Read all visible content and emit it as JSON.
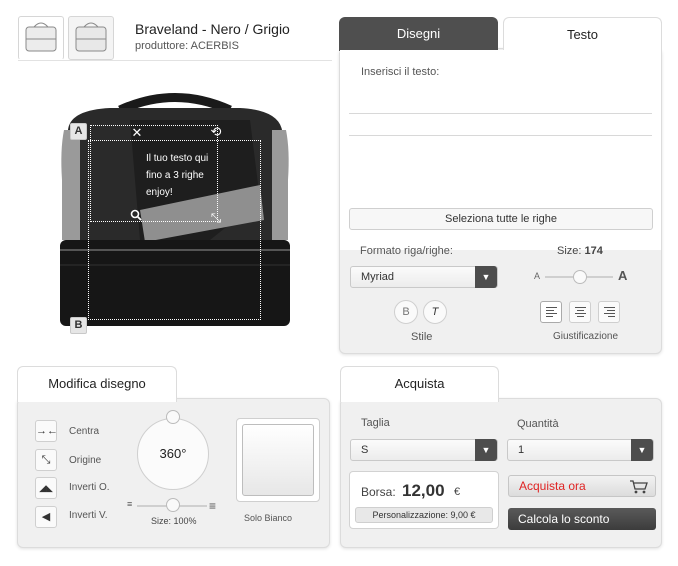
{
  "product": {
    "title": "Braveland - Nero / Grigio",
    "manufacturer": "produttore: ACERBIS",
    "thumbnails": [
      "bag-thumbnail",
      "bag-thumbnail"
    ]
  },
  "canvas": {
    "corner_top": "A",
    "corner_bottom": "B",
    "text_lines": [
      "Il tuo testo qui",
      "fino a 3 righe",
      "enjoy!"
    ],
    "handles": {
      "close": "✕",
      "rotate": "⟲",
      "zoom": "🔍",
      "resize": "⤡"
    }
  },
  "design_tabs": {
    "drawings": "Disegni",
    "text": "Testo"
  },
  "text_panel": {
    "input_label": "Inserisci il testo:",
    "select_all": "Seleziona tutte le righe",
    "format_label": "Formato riga/righe:",
    "font_value": "Myriad",
    "size_label": "Size:",
    "size_value": "174",
    "size_small": "A",
    "size_large": "A",
    "bold": "B",
    "italic": "T",
    "style_label": "Stile",
    "justify_label": "Giustificazione"
  },
  "edit_panel": {
    "tab": "Modifica disegno",
    "center": "Centra",
    "origin": "Origine",
    "flip_h": "Inverti O.",
    "flip_v": "Inverti V.",
    "rotation": "360°",
    "size_label": "Size: 100%",
    "white_only": "Solo Bianco",
    "icons": {
      "center": "→←",
      "origin": "⤡",
      "flip_h": "◢◣",
      "flip_v": "◀"
    }
  },
  "buy_panel": {
    "tab": "Acquista",
    "size_label": "Taglia",
    "size_value": "S",
    "qty_label": "Quantità",
    "qty_value": "1",
    "price_label": "Borsa:",
    "price_value": "12,00",
    "price_currency": "€",
    "personalization": "Personalizzazione: 9,00 €",
    "buy_now": "Acquista ora",
    "discount": "Calcola lo sconto"
  },
  "colors": {
    "dark_tab": "#4f4f4f",
    "buy_red": "#e02424",
    "panel_bg": "#f0f0f0"
  }
}
